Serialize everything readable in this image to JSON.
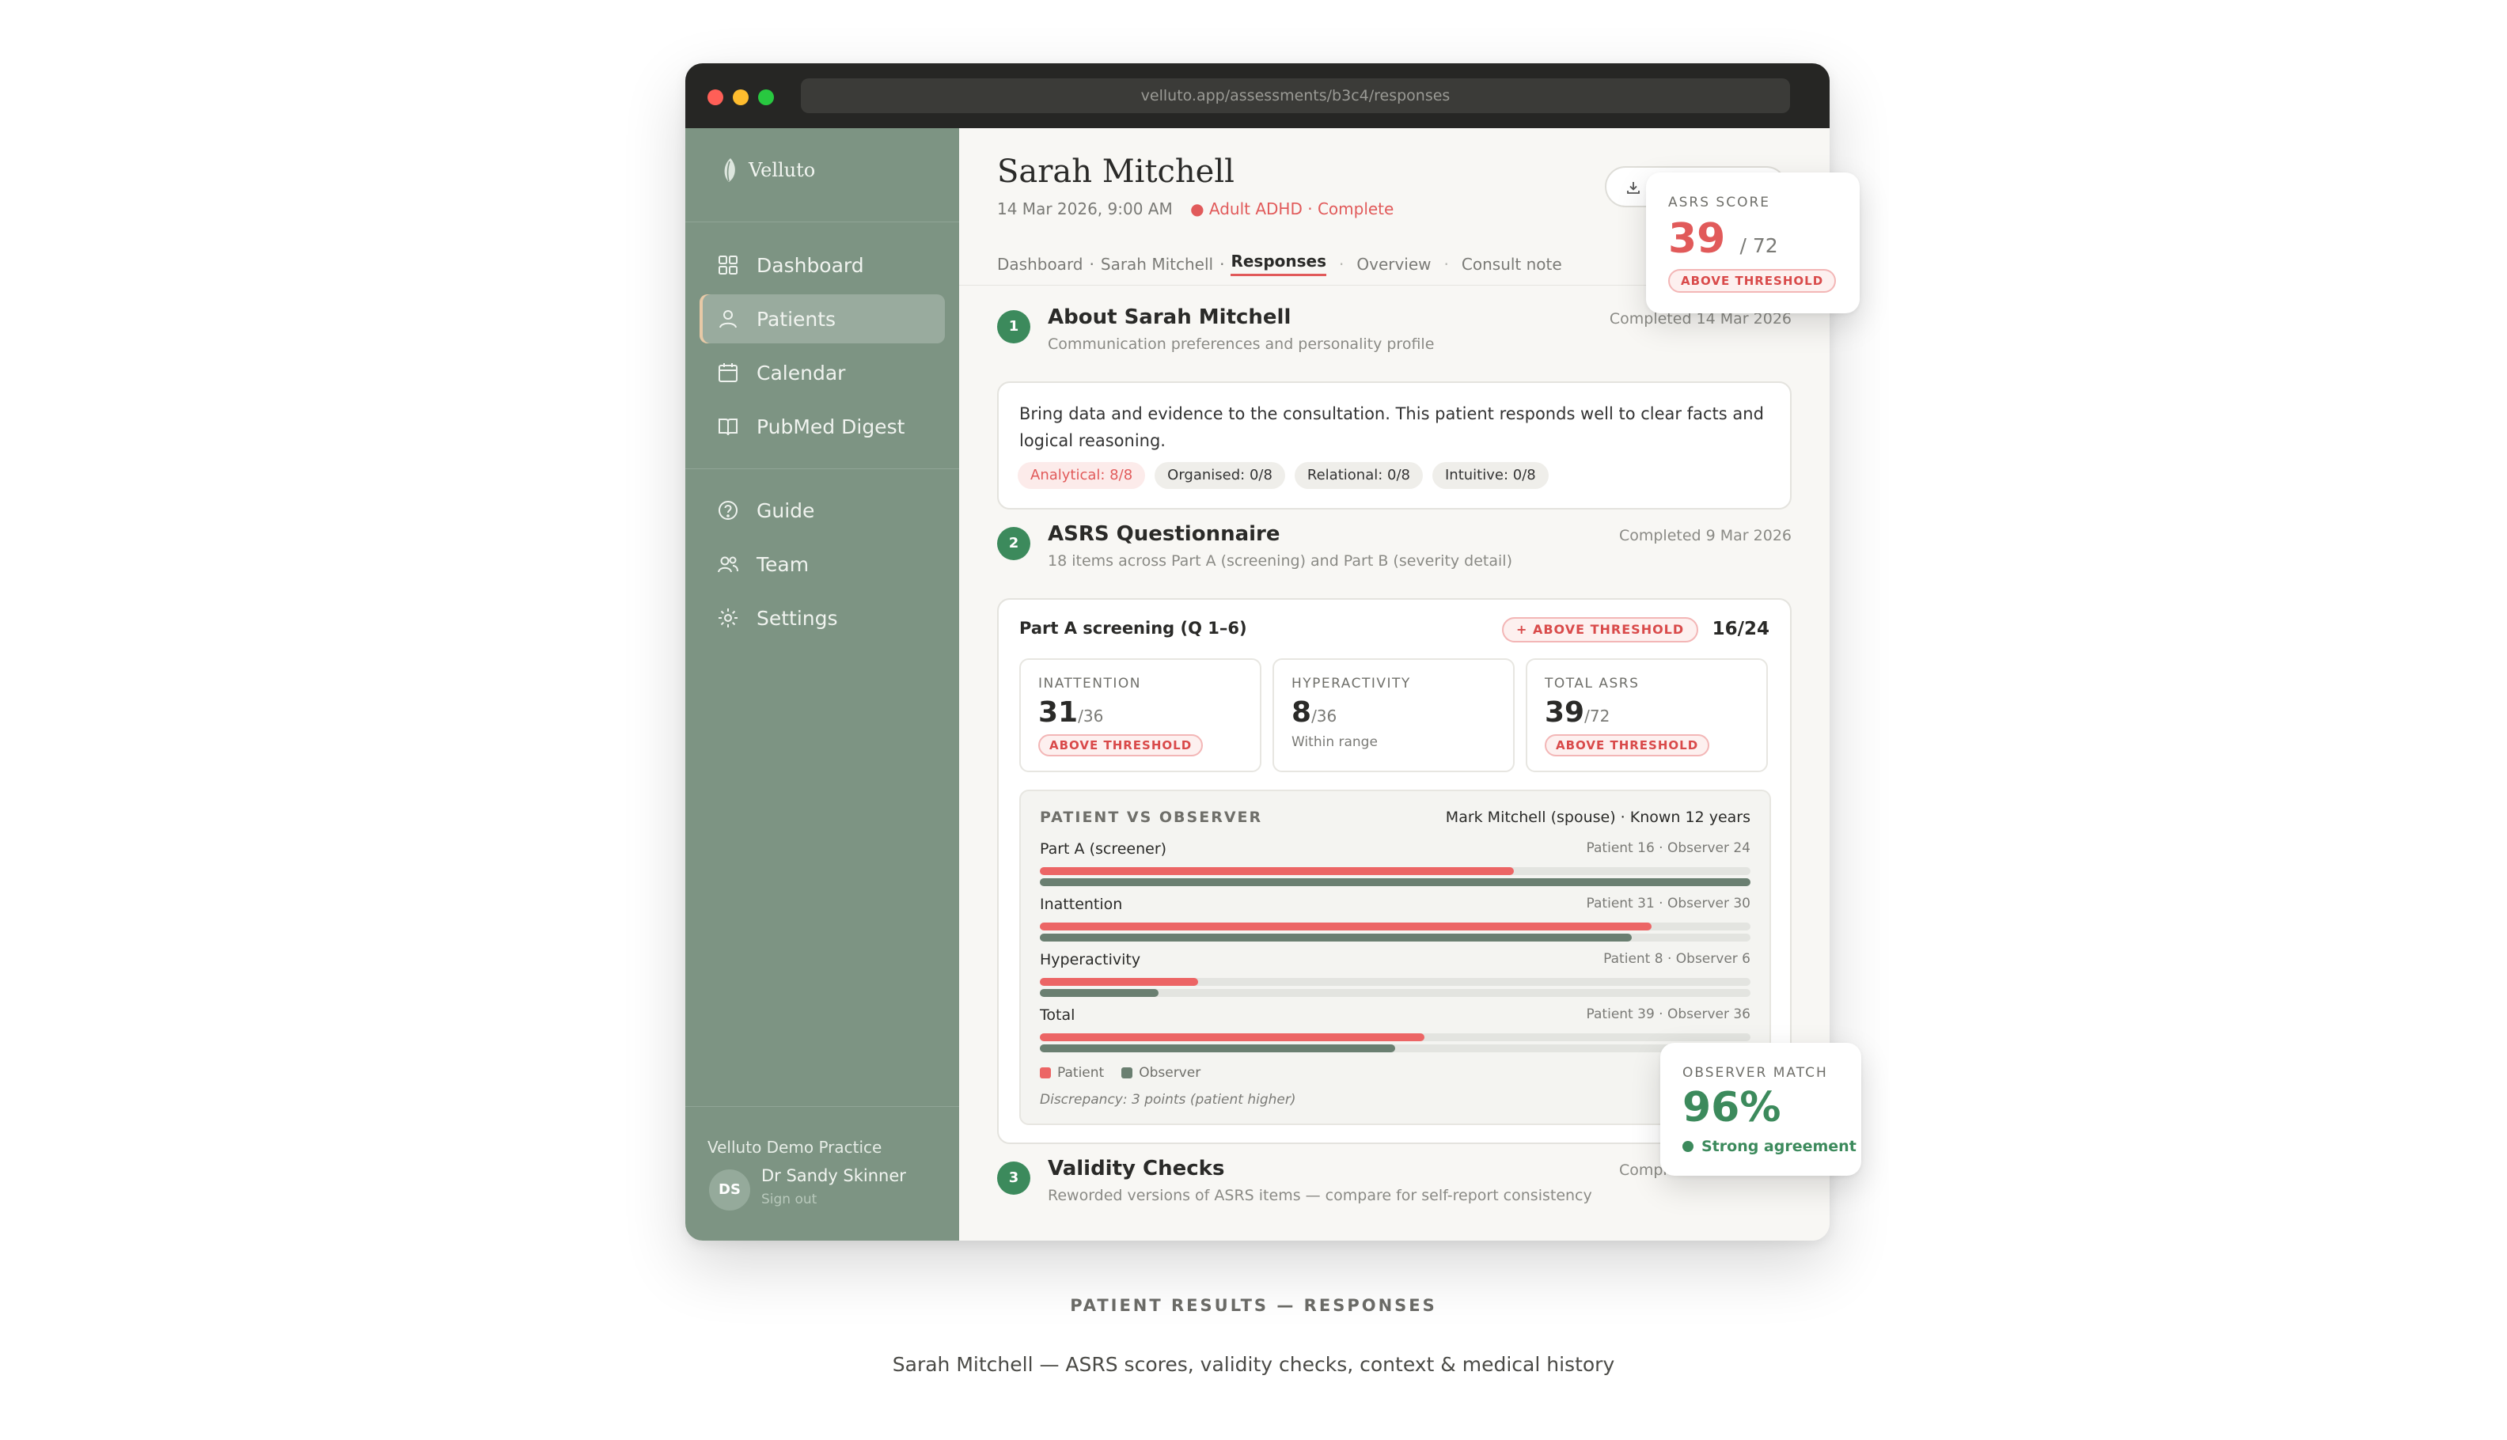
{
  "browser": {
    "url": "velluto.app/assessments/b3c4/responses"
  },
  "sidebar": {
    "brand": "Velluto",
    "nav_primary": [
      {
        "label": "Dashboard",
        "icon": "grid-icon"
      },
      {
        "label": "Patients",
        "icon": "user-icon",
        "active": true
      },
      {
        "label": "Calendar",
        "icon": "calendar-icon"
      },
      {
        "label": "PubMed Digest",
        "icon": "book-icon"
      }
    ],
    "nav_secondary": [
      {
        "label": "Guide",
        "icon": "help-circle-icon"
      },
      {
        "label": "Team",
        "icon": "users-icon"
      },
      {
        "label": "Settings",
        "icon": "gear-icon"
      }
    ],
    "practice": "Velluto Demo Practice",
    "user": {
      "initials": "DS",
      "name": "Dr Sandy Skinner",
      "signout": "Sign out"
    }
  },
  "header": {
    "patient_name": "Sarah Mitchell",
    "datetime": "14 Mar 2026, 9:00 AM",
    "status": "● Adult ADHD · Complete",
    "breadcrumb": [
      "Dashboard",
      "Sarah Mitchell",
      "Responses"
    ],
    "tabs": [
      "Overview",
      "Consult note"
    ]
  },
  "sections": {
    "about": {
      "number": "1",
      "title": "About Sarah Mitchell",
      "subtitle": "Communication preferences and personality profile",
      "completed": "Completed 14 Mar 2026",
      "text": "Bring data and evidence to the consultation. This patient responds well to clear facts and logical reasoning.",
      "chips": [
        "Analytical: 8/8",
        "Organised: 0/8",
        "Relational: 0/8",
        "Intuitive: 0/8"
      ]
    },
    "asrs": {
      "number": "2",
      "title": "ASRS Questionnaire",
      "subtitle": "18 items across Part A (screening) and Part B (severity detail)",
      "completed": "Completed 9 Mar 2026",
      "parta_title": "Part A screening (Q 1–6)",
      "parta_badge": "+ ABOVE THRESHOLD",
      "parta_score": "16/24",
      "stats": [
        {
          "label": "INATTENTION",
          "value": "31",
          "denom": "/36",
          "badge": "ABOVE THRESHOLD"
        },
        {
          "label": "HYPERACTIVITY",
          "value": "8",
          "denom": "/36",
          "note": "Within range"
        },
        {
          "label": "TOTAL ASRS",
          "value": "39",
          "denom": "/72",
          "badge": "ABOVE THRESHOLD"
        }
      ],
      "comparison": {
        "title": "PATIENT VS OBSERVER",
        "observer": "Mark Mitchell (spouse) · Known 12 years",
        "rows": [
          {
            "label": "Part A (screener)",
            "values_text": "Patient 16 · Observer 24",
            "patient": 16,
            "observer": 24,
            "max": 24
          },
          {
            "label": "Inattention",
            "values_text": "Patient 31 · Observer 30",
            "patient": 31,
            "observer": 30,
            "max": 36
          },
          {
            "label": "Hyperactivity",
            "values_text": "Patient 8 · Observer 6",
            "patient": 8,
            "observer": 6,
            "max": 36
          },
          {
            "label": "Total",
            "values_text": "Patient 39 · Observer 36",
            "patient": 39,
            "observer": 36,
            "max": 72
          }
        ],
        "legend_patient": "Patient",
        "legend_observer": "Observer",
        "discrepancy": "Discrepancy: 3 points (patient higher)"
      }
    },
    "validity": {
      "number": "3",
      "title": "Validity Checks",
      "subtitle": "Reworded versions of ASRS items — compare for self-report consistency",
      "completed": "Completed 9 Mar 2026"
    }
  },
  "float_score": {
    "label": "ASRS SCORE",
    "value": "39",
    "denom": "/ 72",
    "badge": "ABOVE THRESHOLD"
  },
  "float_match": {
    "label": "OBSERVER MATCH",
    "value": "96%",
    "note": "Strong agreement"
  },
  "caption": {
    "title": "PATIENT RESULTS — RESPONSES",
    "subtitle": "Sarah Mitchell — ASRS scores, validity checks, context & medical history"
  },
  "colors": {
    "accent_red": "#e15a5a",
    "accent_green": "#3c8a5c",
    "sidebar": "#7d9483",
    "observer_bar": "#6a7f71",
    "patient_bar": "#ec6565"
  }
}
